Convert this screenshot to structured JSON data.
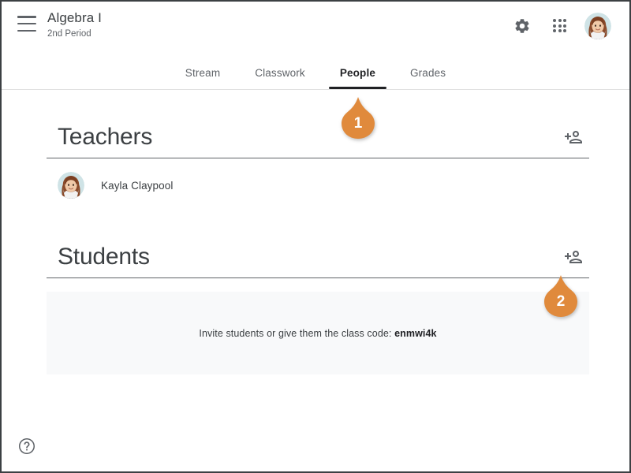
{
  "header": {
    "menu_icon": "hamburger-menu-icon",
    "class_title": "Algebra I",
    "class_section": "2nd Period",
    "settings_icon": "gear-icon",
    "apps_icon": "apps-grid-icon",
    "avatar_icon": "user-avatar"
  },
  "tabs": [
    {
      "label": "Stream",
      "active": false
    },
    {
      "label": "Classwork",
      "active": false
    },
    {
      "label": "People",
      "active": true
    },
    {
      "label": "Grades",
      "active": false
    }
  ],
  "teachers": {
    "title": "Teachers",
    "invite_icon": "person-add-icon",
    "people": [
      {
        "name": "Kayla Claypool",
        "avatar": "teacher-avatar"
      }
    ]
  },
  "students": {
    "title": "Students",
    "invite_icon": "person-add-icon",
    "invite_message_prefix": "Invite students or give them the class code: ",
    "class_code": "enmwi4k"
  },
  "footer": {
    "help_icon": "help-circle-icon"
  },
  "callouts": [
    {
      "number": "1",
      "target": "people-tab"
    },
    {
      "number": "2",
      "target": "students-invite-button"
    }
  ],
  "colors": {
    "callout_orange": "#e08a3c",
    "active_tab": "#202124",
    "muted_text": "#5f6368",
    "invite_box_bg": "#f8f9fa"
  }
}
